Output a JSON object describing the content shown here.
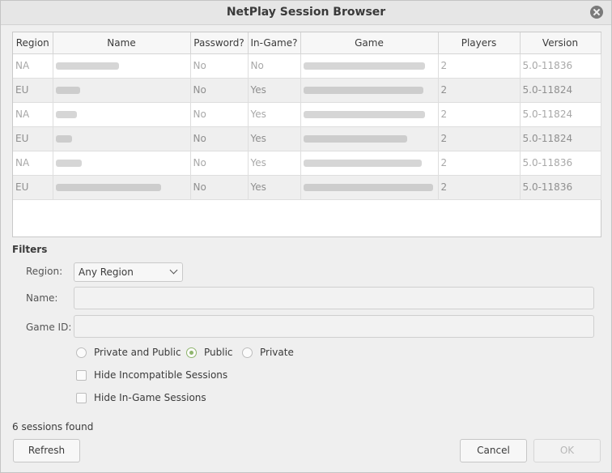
{
  "window": {
    "title": "NetPlay Session Browser"
  },
  "table": {
    "columns": [
      "Region",
      "Name",
      "Password?",
      "In-Game?",
      "Game",
      "Players",
      "Version"
    ],
    "rows": [
      {
        "region": "NA",
        "password": "No",
        "in_game": "No",
        "players": "2",
        "version": "5.0-11836"
      },
      {
        "region": "EU",
        "password": "No",
        "in_game": "Yes",
        "players": "2",
        "version": "5.0-11824"
      },
      {
        "region": "NA",
        "password": "No",
        "in_game": "Yes",
        "players": "2",
        "version": "5.0-11824"
      },
      {
        "region": "EU",
        "password": "No",
        "in_game": "Yes",
        "players": "2",
        "version": "5.0-11824"
      },
      {
        "region": "NA",
        "password": "No",
        "in_game": "Yes",
        "players": "2",
        "version": "5.0-11836"
      },
      {
        "region": "EU",
        "password": "No",
        "in_game": "Yes",
        "players": "2",
        "version": "5.0-11836"
      }
    ]
  },
  "filters": {
    "title": "Filters",
    "region_label": "Region:",
    "region_value": "Any Region",
    "name_label": "Name:",
    "name_value": "",
    "game_id_label": "Game ID:",
    "game_id_value": "",
    "visibility_options": [
      "Private and Public",
      "Public",
      "Private"
    ],
    "visibility_selected": "Public",
    "hide_incompatible_label": "Hide Incompatible Sessions",
    "hide_in_game_label": "Hide In-Game Sessions"
  },
  "status": "6 sessions found",
  "buttons": {
    "refresh": "Refresh",
    "cancel": "Cancel",
    "ok": "OK"
  },
  "colors": {
    "accent": "#8fb56d",
    "window_bg": "#efefef"
  }
}
